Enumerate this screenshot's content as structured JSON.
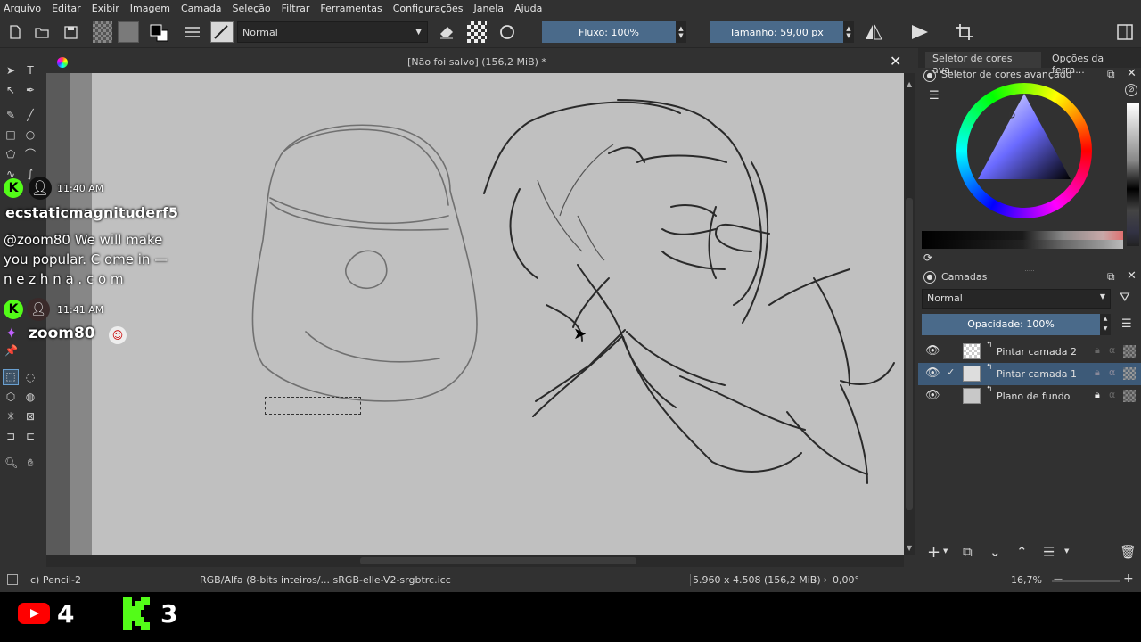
{
  "menu": [
    "Arquivo",
    "Editar",
    "Exibir",
    "Imagem",
    "Camada",
    "Seleção",
    "Filtrar",
    "Ferramentas",
    "Configurações",
    "Janela",
    "Ajuda"
  ],
  "toolbar": {
    "blend_mode": "Normal",
    "flow": "Fluxo: 100%",
    "size": "Tamanho: 59,00 px"
  },
  "document": {
    "title": "[Não foi salvo]  (156,2 MiB) *"
  },
  "panels": {
    "tab1": "Seletor de cores ava...",
    "tab2": "Opções da ferra...",
    "color_selector_title": "Seletor de cores avançado",
    "layers_title": "Camadas",
    "layers_blend": "Normal",
    "opacity": "Opacidade:  100%",
    "layers": [
      {
        "name": "Pintar camada 2",
        "selected": false
      },
      {
        "name": "Pintar camada 1",
        "selected": true
      },
      {
        "name": "Plano de fundo",
        "selected": false
      }
    ]
  },
  "status": {
    "brush": "c) Pencil-2",
    "color_profile": "RGB/Alfa (8-bits inteiros/...  sRGB-elle-V2-srgbtrc.icc",
    "dimensions": "5.960 x 4.508 (156,2 MiB)",
    "rotation": "0,00°",
    "zoom": "16,7%"
  },
  "chat": {
    "time1": "11:40 AM",
    "user1": "ecstaticmagnituderf5",
    "message1a": "@zoom80 We will make",
    "message1b": "you popular. C ome in —",
    "message1c": "n e z h n a . c o m",
    "time2": "11:41 AM",
    "user2": "zoom80"
  },
  "counters": {
    "youtube": "4",
    "kick": "3"
  },
  "colors": {
    "accent": "#4a6a8a",
    "kick": "#53fc18",
    "youtube": "#ff0000"
  }
}
